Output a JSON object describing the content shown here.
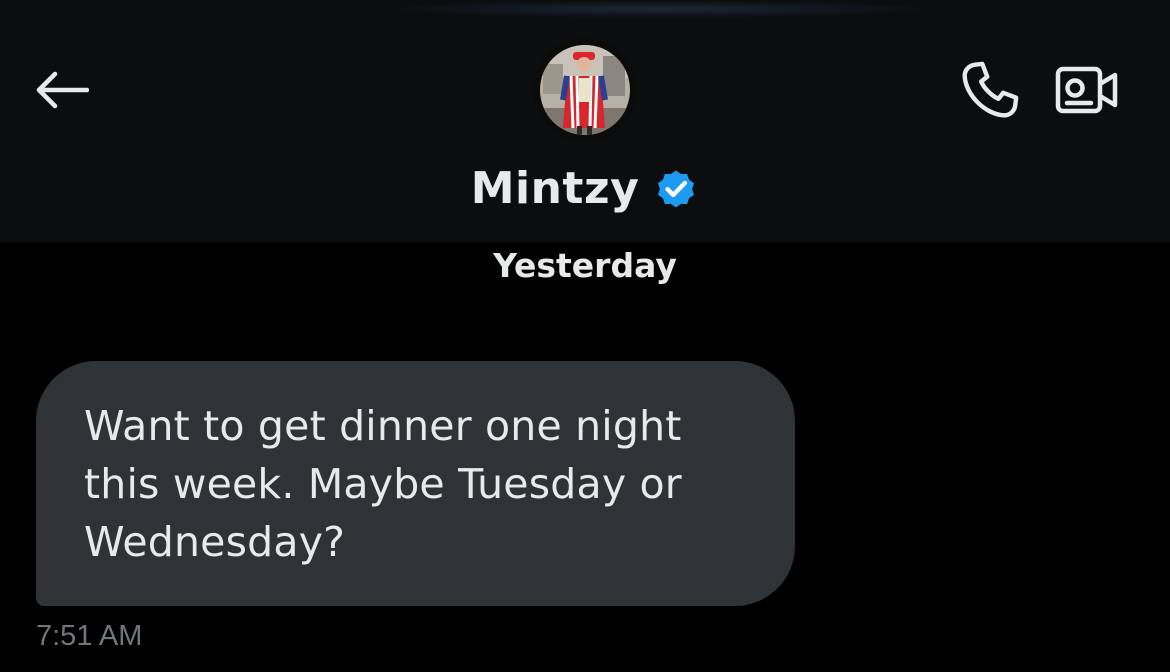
{
  "header": {
    "contact_name": "Mintzy",
    "verified": true,
    "icons": {
      "back": "arrow-left-icon",
      "call": "phone-icon",
      "video": "video-camera-icon",
      "verified": "verified-badge-icon"
    }
  },
  "conversation": {
    "day_divider": "Yesterday",
    "messages": [
      {
        "direction": "received",
        "text": "Want to get dinner one night this week. Maybe Tuesday or Wednesday?",
        "time": "7:51 AM"
      }
    ]
  },
  "colors": {
    "background": "#000000",
    "header_background": "#0c0d0e",
    "bubble_received": "#2f3336",
    "text_primary": "#e7e9ea",
    "text_secondary": "#71767b",
    "verified_blue": "#1d9bf0"
  }
}
